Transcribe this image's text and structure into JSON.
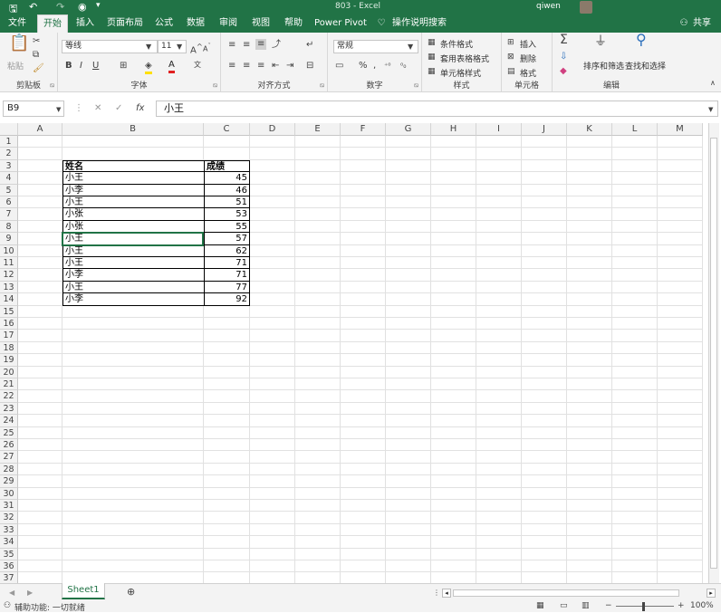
{
  "title": {
    "file": "803",
    "app": "Excel",
    "user": "qiwen"
  },
  "colors": {
    "accent": "#217346"
  },
  "tabs": [
    "文件",
    "开始",
    "插入",
    "页面布局",
    "公式",
    "数据",
    "审阅",
    "视图",
    "帮助",
    "Power Pivot"
  ],
  "tell_me": "操作说明搜索",
  "share": "共享",
  "ribbon": {
    "clipboard": {
      "paste": "粘贴",
      "label": "剪贴板"
    },
    "font": {
      "name": "等线",
      "size": "11",
      "label": "字体",
      "bold": "B",
      "italic": "I",
      "underline": "U"
    },
    "alignment": {
      "label": "对齐方式"
    },
    "number": {
      "format": "常规",
      "label": "数字"
    },
    "styles": {
      "conditional": "条件格式",
      "table": "套用表格格式",
      "cell": "单元格样式",
      "label": "样式"
    },
    "cells": {
      "insert": "插入",
      "delete": "删除",
      "format": "格式",
      "label": "单元格"
    },
    "editing": {
      "sort": "排序和筛选",
      "find": "查找和选择",
      "label": "编辑"
    }
  },
  "name_box": "B9",
  "formula_value": "小王",
  "columns": [
    "A",
    "B",
    "C",
    "D",
    "E",
    "F",
    "G",
    "H",
    "I",
    "J",
    "K",
    "L",
    "M"
  ],
  "rows": [
    "1",
    "2",
    "3",
    "4",
    "5",
    "6",
    "7",
    "8",
    "9",
    "10",
    "11",
    "12",
    "13",
    "14",
    "15",
    "16",
    "17",
    "18",
    "19",
    "20",
    "21",
    "22",
    "23",
    "24",
    "25",
    "26",
    "27",
    "28",
    "29",
    "30",
    "31",
    "32",
    "33",
    "34",
    "35",
    "36",
    "37"
  ],
  "table": {
    "headers": [
      "姓名",
      "成绩"
    ],
    "rows": [
      [
        "小王",
        "45"
      ],
      [
        "小李",
        "46"
      ],
      [
        "小王",
        "51"
      ],
      [
        "小张",
        "53"
      ],
      [
        "小张",
        "55"
      ],
      [
        "小王",
        "57"
      ],
      [
        "小王",
        "62"
      ],
      [
        "小王",
        "71"
      ],
      [
        "小李",
        "71"
      ],
      [
        "小王",
        "77"
      ],
      [
        "小李",
        "92"
      ]
    ]
  },
  "sheets": [
    "Sheet1"
  ],
  "status": {
    "accessibility": "辅助功能: 一切就绪",
    "zoom": "100%"
  }
}
